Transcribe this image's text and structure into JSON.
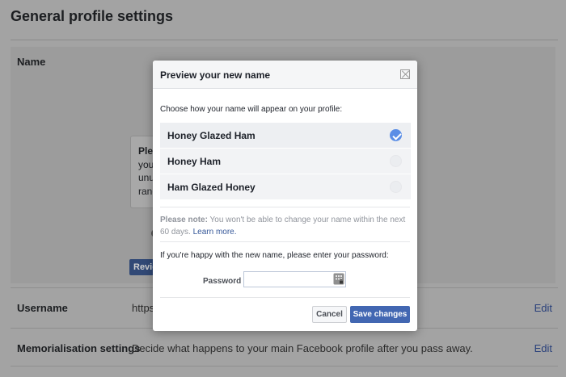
{
  "page": {
    "title": "General profile settings",
    "name_row": {
      "label": "Name",
      "notice_lines": [
        "Plea",
        "you",
        "unu",
        "ranc"
      ],
      "review_button": "Revie"
    },
    "username_row": {
      "label": "Username",
      "value": "https:",
      "edit": "Edit"
    },
    "memorial_row": {
      "label": "Memorialisation settings",
      "value": "Decide what happens to your main Facebook profile after you pass away.",
      "edit": "Edit"
    }
  },
  "modal": {
    "title": "Preview your new name",
    "intro": "Choose how your name will appear on your profile:",
    "options": [
      {
        "label": "Honey Glazed Ham",
        "selected": true
      },
      {
        "label": "Honey Ham",
        "selected": false
      },
      {
        "label": "Ham Glazed Honey",
        "selected": false
      }
    ],
    "note_prefix": "Please note:",
    "note_text": " You won't be able to change your name within the next 60 days. ",
    "learn_more": "Learn more.",
    "password_prompt": "If you're happy with the new name, please enter your password:",
    "password_label": "Password",
    "password_value": "",
    "cancel_label": "Cancel",
    "save_label": "Save changes"
  },
  "colors": {
    "accent": "#4267b2",
    "link": "#365899",
    "radio_checked": "#5b8ee6",
    "overlay": "#a3a3a3"
  },
  "icons": {
    "close": "close-icon",
    "checked_radio": "check-icon",
    "password_manager": "key-icon"
  }
}
